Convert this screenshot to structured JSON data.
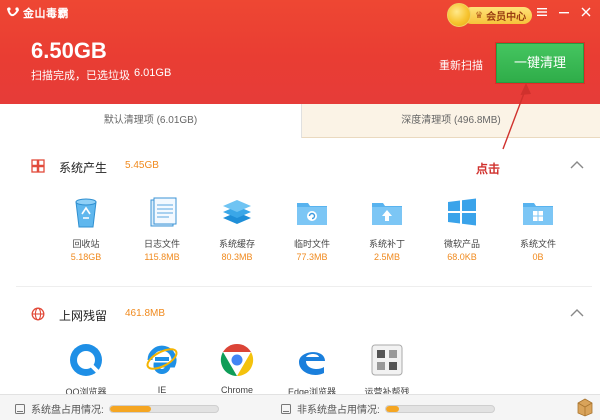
{
  "header": {
    "app_name": "金山毒霸",
    "vip_label": "会员中心",
    "total_size": "6.50GB",
    "scan_status": "扫描完成，已选垃圾",
    "selected_size": "6.01GB",
    "rescan_label": "重新扫描",
    "clean_button": "一键清理",
    "menu_icon": "hamburger-icon",
    "minimize_icon": "minimize-icon",
    "close_icon": "close-icon"
  },
  "tabs": [
    {
      "label": "默认清理项 (6.01GB)",
      "active": true
    },
    {
      "label": "深度清理项 (496.8MB)",
      "active": false
    }
  ],
  "annotation": {
    "text": "点击",
    "color": "#d0312d"
  },
  "sections": [
    {
      "title": "系统产生",
      "size": "5.45GB",
      "icon": "windows-logo-icon",
      "items": [
        {
          "label": "回收站",
          "size": "5.18GB",
          "icon": "recycle-bin-icon"
        },
        {
          "label": "日志文件",
          "size": "115.8MB",
          "icon": "log-file-icon"
        },
        {
          "label": "系统缓存",
          "size": "80.3MB",
          "icon": "system-cache-icon"
        },
        {
          "label": "临时文件",
          "size": "77.3MB",
          "icon": "temp-folder-icon"
        },
        {
          "label": "系统补丁",
          "size": "2.5MB",
          "icon": "patch-folder-icon"
        },
        {
          "label": "微软产品",
          "size": "68.0KB",
          "icon": "microsoft-logo-icon"
        },
        {
          "label": "系统文件",
          "size": "0B",
          "icon": "windows-folder-icon"
        }
      ]
    },
    {
      "title": "上网残留",
      "size": "461.8MB",
      "icon": "globe-icon",
      "items": [
        {
          "label": "QQ浏览器",
          "icon": "qq-browser-icon"
        },
        {
          "label": "IE",
          "icon": "ie-icon"
        },
        {
          "label": "Chrome",
          "icon": "chrome-icon"
        },
        {
          "label": "Edge浏览器",
          "icon": "edge-icon"
        },
        {
          "label": "运营补帮残",
          "icon": "misc-app-icon"
        }
      ]
    }
  ],
  "footer": {
    "system_disk_label": "系统盘占用情况:",
    "system_disk_usage": 0.38,
    "other_disk_label": "非系统盘占用情况:",
    "other_disk_usage": 0.12
  },
  "colors": {
    "header_red": "#e93d33",
    "clean_green": "#33b04d",
    "size_orange": "#f08a1e",
    "vip_gold": "#f6c23a"
  }
}
